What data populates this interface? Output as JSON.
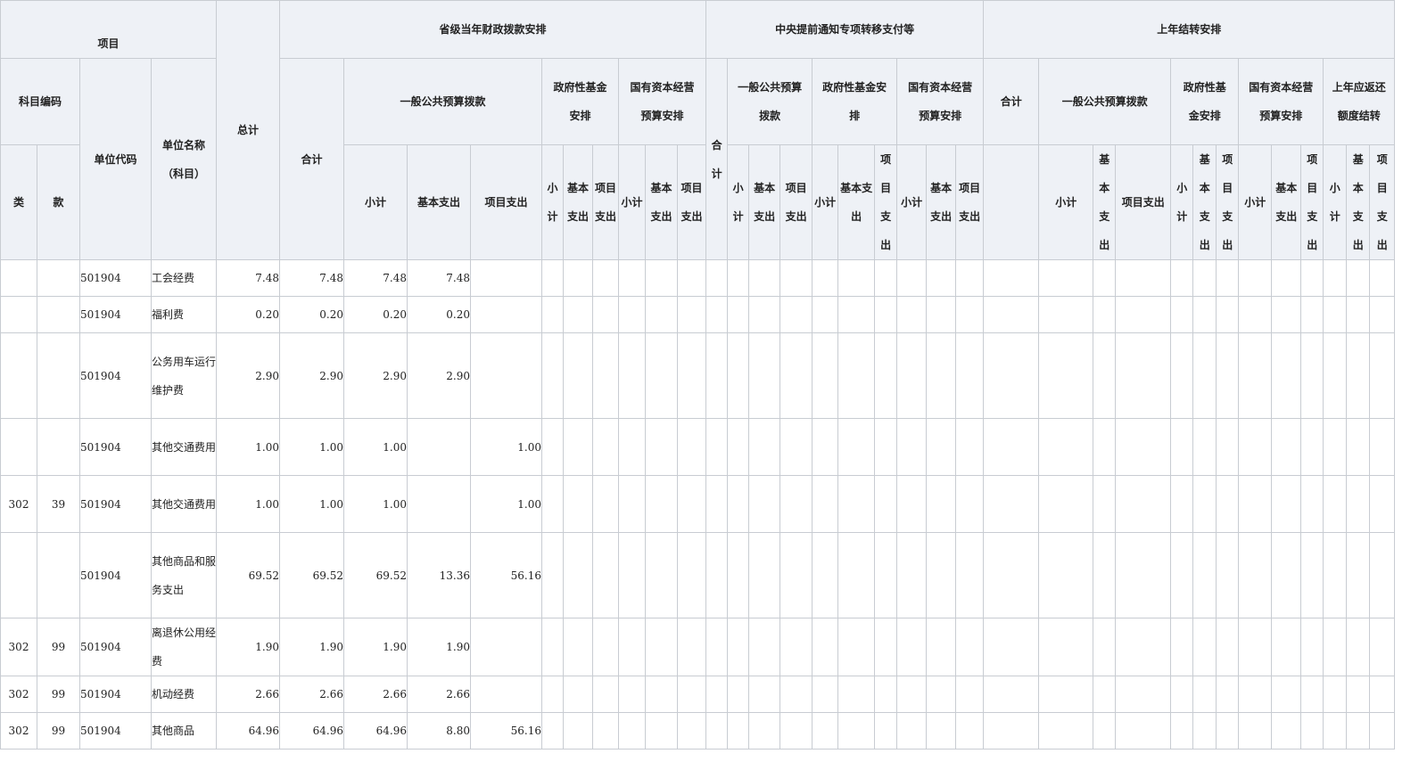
{
  "header": {
    "project": "项目",
    "subject_code": "科目编码",
    "category": "类",
    "item": "款",
    "unit_code": "单位代码",
    "unit_name": "单位名称（科目）",
    "grand_total": "总计",
    "group_provincial": "省级当年财政拨款安排",
    "group_central": "中央提前通知专项转移支付等",
    "group_carryover": "上年结转安排",
    "total": "合计",
    "general_budget": "一般公共预算拨款",
    "general_budget_central": "一般公共预算拨款",
    "gov_fund": "政府性基金安排",
    "state_capital": "国有资本经营预算安排",
    "prior_refund": "上年应返还额度结转",
    "subtotal": "小计",
    "basic_exp": "基本支出",
    "project_exp": "项目支出"
  },
  "rows": [
    {
      "cls": "",
      "kuan": "",
      "code": "501904",
      "name": "工会经费",
      "total": "7.48",
      "sum": "7.48",
      "sub": "7.48",
      "basic": "7.48",
      "proj": ""
    },
    {
      "cls": "",
      "kuan": "",
      "code": "501904",
      "name": "福利费",
      "total": "0.20",
      "sum": "0.20",
      "sub": "0.20",
      "basic": "0.20",
      "proj": ""
    },
    {
      "cls": "",
      "kuan": "",
      "code": "501904",
      "name": "公务用车运行维护费",
      "total": "2.90",
      "sum": "2.90",
      "sub": "2.90",
      "basic": "2.90",
      "proj": ""
    },
    {
      "cls": "",
      "kuan": "",
      "code": "501904",
      "name": "其他交通费用",
      "total": "1.00",
      "sum": "1.00",
      "sub": "1.00",
      "basic": "",
      "proj": "1.00"
    },
    {
      "cls": "302",
      "kuan": "39",
      "code": "501904",
      "name": "其他交通费用",
      "total": "1.00",
      "sum": "1.00",
      "sub": "1.00",
      "basic": "",
      "proj": "1.00"
    },
    {
      "cls": "",
      "kuan": "",
      "code": "501904",
      "name": "其他商品和服务支出",
      "total": "69.52",
      "sum": "69.52",
      "sub": "69.52",
      "basic": "13.36",
      "proj": "56.16"
    },
    {
      "cls": "302",
      "kuan": "99",
      "code": "501904",
      "name": "离退休公用经费",
      "total": "1.90",
      "sum": "1.90",
      "sub": "1.90",
      "basic": "1.90",
      "proj": ""
    },
    {
      "cls": "302",
      "kuan": "99",
      "code": "501904",
      "name": "机动经费",
      "total": "2.66",
      "sum": "2.66",
      "sub": "2.66",
      "basic": "2.66",
      "proj": ""
    },
    {
      "cls": "302",
      "kuan": "99",
      "code": "501904",
      "name": "其他商品",
      "total": "64.96",
      "sum": "64.96",
      "sub": "64.96",
      "basic": "8.80",
      "proj": "56.16"
    }
  ]
}
